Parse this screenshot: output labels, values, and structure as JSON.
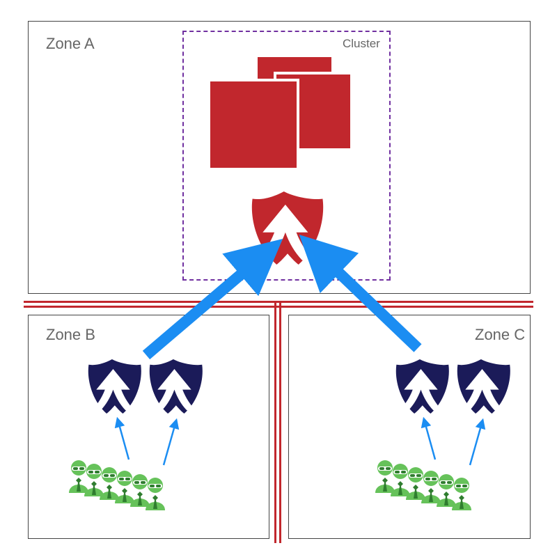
{
  "diagram": {
    "zoneA": {
      "label": "Zone A"
    },
    "zoneB": {
      "label": "Zone B"
    },
    "zoneC": {
      "label": "Zone C"
    },
    "cluster": {
      "label": "Cluster"
    },
    "colors": {
      "accent_red": "#c1272d",
      "accent_blue": "#1b8df2",
      "dark_navy": "#1b1b59",
      "user_green": "#66c25a",
      "cluster_border": "#7030a0"
    },
    "arrows": {
      "fromZoneB_toZoneA": true,
      "fromZoneC_toZoneA": true,
      "usersB_toShieldsB": true,
      "usersC_toShieldsC": true
    },
    "elements": {
      "zoneA_cluster_nodes": 3,
      "zoneA_shield_icon": "red shield with white up-arrow",
      "zoneB_shields": 2,
      "zoneC_shields": 2,
      "zoneB_users_row": 6,
      "zoneC_users_row": 6
    }
  }
}
